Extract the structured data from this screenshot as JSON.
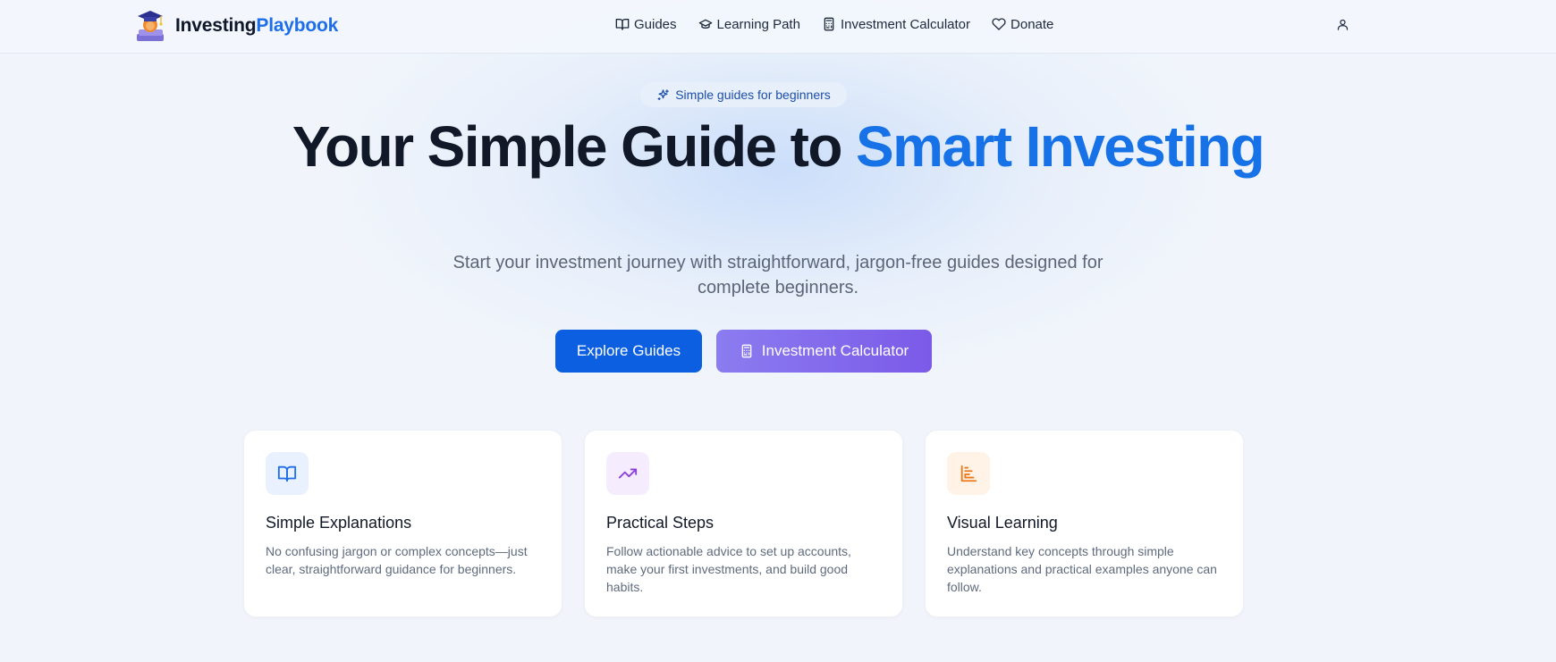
{
  "brand": {
    "name_part1": "Investing",
    "name_part2": "Playbook",
    "accent_color": "#1d6ee8"
  },
  "nav": {
    "items": [
      {
        "label": "Guides",
        "icon": "book-open-icon"
      },
      {
        "label": "Learning Path",
        "icon": "graduation-cap-icon"
      },
      {
        "label": "Investment Calculator",
        "icon": "calculator-icon"
      },
      {
        "label": "Donate",
        "icon": "heart-icon"
      }
    ],
    "user_icon": "user-icon"
  },
  "hero": {
    "badge": "Simple guides for beginners",
    "badge_icon": "sparkles-icon",
    "title_main": "Your Simple Guide to ",
    "title_highlight": "Smart Investing",
    "subtitle": "Start your investment journey with straightforward, jargon-free guides designed for complete beginners.",
    "primary_cta": "Explore Guides",
    "secondary_cta": "Investment Calculator",
    "secondary_cta_icon": "calculator-icon"
  },
  "features": [
    {
      "title": "Simple Explanations",
      "description": "No confusing jargon or complex concepts—just clear, straightforward guidance for beginners.",
      "icon": "book-open-icon",
      "color": "#1d6ee8",
      "bg": "#e8f1fd"
    },
    {
      "title": "Practical Steps",
      "description": "Follow actionable advice to set up accounts, make your first investments, and build good habits.",
      "icon": "trending-up-icon",
      "color": "#8b3fd9",
      "bg": "#f5edfd"
    },
    {
      "title": "Visual Learning",
      "description": "Understand key concepts through simple explanations and practical examples anyone can follow.",
      "icon": "bar-chart-icon",
      "color": "#ea7a1c",
      "bg": "#fef3e6"
    }
  ],
  "colors": {
    "primary": "#0b5fe0",
    "secondary_gradient_start": "#8b7cf0",
    "secondary_gradient_end": "#7b5ae8",
    "highlight": "#1672e6"
  }
}
